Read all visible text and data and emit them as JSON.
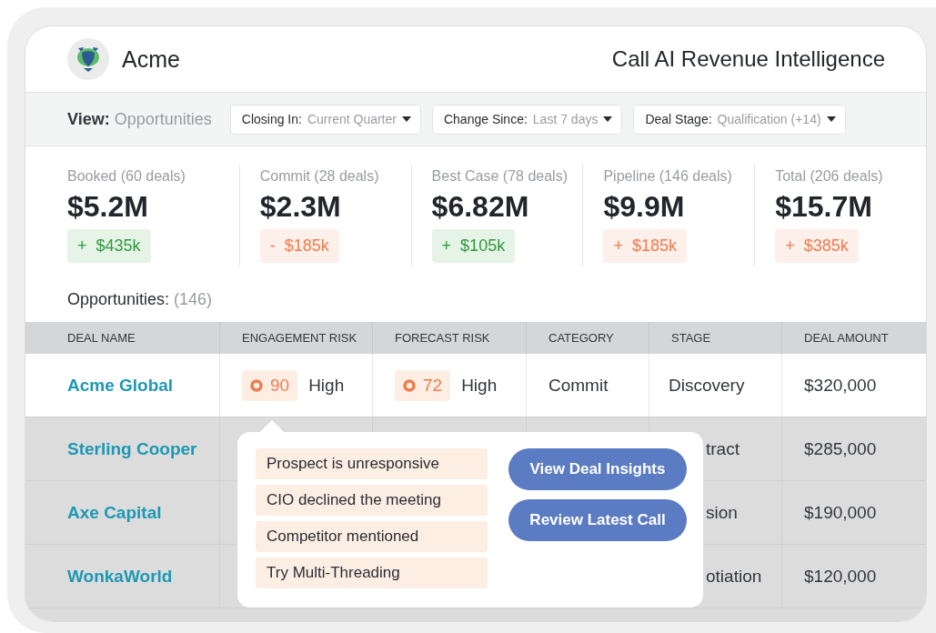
{
  "header": {
    "brand": "Acme",
    "title": "Call AI Revenue Intelligence"
  },
  "view": {
    "label": "View:",
    "value": "Opportunities"
  },
  "filters": [
    {
      "label": "Closing In:",
      "value": "Current Quarter"
    },
    {
      "label": "Change Since:",
      "value": "Last 7 days"
    },
    {
      "label": "Deal Stage:",
      "value": "Qualification (+14)"
    }
  ],
  "metrics": [
    {
      "label": "Booked (60 deals)",
      "amount": "$5.2M",
      "delta": "+  $435k",
      "color": "#2e9b3c"
    },
    {
      "label": "Commit (28 deals)",
      "amount": "$2.3M",
      "delta": "-  $185k",
      "color": "#ef7b4e"
    },
    {
      "label": "Best Case (78 deals)",
      "amount": "$6.82M",
      "delta": "+  $105k",
      "color": "#2e9b3c"
    },
    {
      "label": "Pipeline (146 deals)",
      "amount": "$9.9M",
      "delta": "+  $185k",
      "color": "#ef7b4e"
    },
    {
      "label": "Total (206 deals)",
      "amount": "$15.7M",
      "delta": "+  $385k",
      "color": "#ef7b4e"
    }
  ],
  "section": {
    "title": "Opportunities:",
    "count": "(146)"
  },
  "table": {
    "columns": [
      "DEAL NAME",
      "ENGAGEMENT RISK",
      "FORECAST RISK",
      "CATEGORY",
      "STAGE",
      "DEAL AMOUNT"
    ],
    "rows": [
      {
        "deal": "Acme Global",
        "shaded": false,
        "engagement": {
          "score": "90",
          "level": "High"
        },
        "forecast": {
          "score": "72",
          "level": "High"
        },
        "category": "Commit",
        "stage": "Discovery",
        "amount": "$320,000"
      },
      {
        "deal": "Sterling Cooper",
        "shaded": true,
        "stage": "tract",
        "amount": "$285,000"
      },
      {
        "deal": "Axe Capital",
        "shaded": true,
        "stage": "sion",
        "amount": "$190,000"
      },
      {
        "deal": "WonkaWorld",
        "shaded": true,
        "stage": "otiation",
        "amount": "$120,000"
      }
    ]
  },
  "popover": {
    "insights": [
      "Prospect is unresponsive",
      "CIO declined the meeting",
      "Competitor mentioned",
      "Try Multi-Threading"
    ],
    "actions": [
      "View Deal Insights",
      "Review Latest Call"
    ]
  }
}
